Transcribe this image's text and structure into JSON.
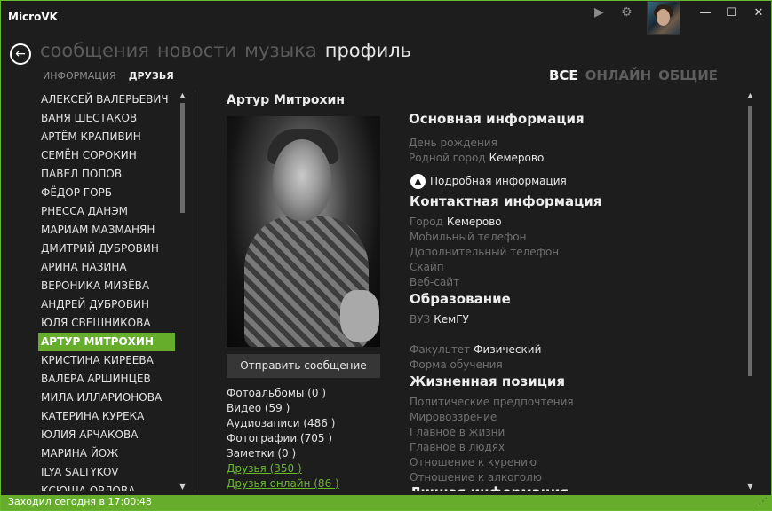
{
  "app": {
    "title": "MicroVK",
    "controls": {
      "play": "▶",
      "settings": "⚙",
      "minimize": "—",
      "maximize": "☐",
      "close": "✕"
    }
  },
  "nav": {
    "back": "←",
    "tabs": [
      "сообщения",
      "новости",
      "музыка",
      "профиль"
    ],
    "subtabs": [
      "ИНФОРМАЦИЯ",
      "ДРУЗЬЯ"
    ],
    "filters": [
      "ВСЕ",
      "ОНЛАЙН",
      "ОБЩИЕ"
    ]
  },
  "friends": [
    "АЛЕКСЕЙ ВАЛЕРЬЕВИЧ",
    "ВАНЯ ШЕСТАКОВ",
    "АРТЁМ КРАПИВИН",
    "СЕМЁН СОРОКИН",
    "ПАВЕЛ ПОПОВ",
    "ФЁДОР ГОРБ",
    "РНЕССА ДАНЭМ",
    "МАРИАМ МАЗМАНЯН",
    "ДМИТРИЙ ДУБРОВИН",
    "АРИНА НАЗИНА",
    "ВЕРОНИКА МИЗЁВА",
    "АНДРЕЙ ДУБРОВИН",
    "ЮЛЯ СВЕШНИКОВА",
    "АРТУР МИТРОХИН",
    "КРИСТИНА КИРЕЕВА",
    "ВАЛЕРА АРШИНЦЕВ",
    "МИЛА ИЛЛАРИОНОВА",
    "КАТЕРИНА КУРЕКА",
    "ЮЛИЯ АРЧАКОВА",
    "МАРИНА ЙОЖ",
    "ILYA SALTYKOV",
    "КСЮША ОРЛОВА"
  ],
  "profile": {
    "name": "Артур  Митрохин",
    "send_message": "Отправить сообщение",
    "stats": [
      "Фотоальбомы (0 )",
      "Видео (59 )",
      "Аудиозаписи (486 )",
      "Фотографии (705 )",
      "Заметки (0 )"
    ],
    "links": [
      "Друзья (350 )",
      "Друзья онлайн (86 )"
    ],
    "basic": {
      "title": "Основная информация",
      "birthday_label": "День рождения",
      "hometown_label": "Родной город",
      "hometown": "Кемерово",
      "more": "Подробная информация"
    },
    "contacts": {
      "title": "Контактная информация",
      "city_label": "Город",
      "city": "Кемерово",
      "mobile_label": "Мобильный телефон",
      "extra_phone_label": "Дополнительный телефон",
      "skype_label": "Скайп",
      "site_label": "Веб-сайт"
    },
    "education": {
      "title": "Образование",
      "uni_label": "ВУЗ",
      "uni": "КемГУ",
      "faculty_label": "Факультет",
      "faculty": "Физический",
      "form_label": "Форма обучения"
    },
    "life": {
      "title": "Жизненная позиция",
      "items": [
        "Политические предпочтения",
        "Мировоззрение",
        "Главное в жизни",
        "Главное в людях",
        "Отношение к курению",
        "Отношение к алкоголю"
      ]
    },
    "personal_title": "Личная информация"
  },
  "status": {
    "text": "Заходил сегодня в 17:00:48",
    "grip": "⋰"
  },
  "colors": {
    "accent": "#66ad2c",
    "background": "#1d1d1d"
  }
}
